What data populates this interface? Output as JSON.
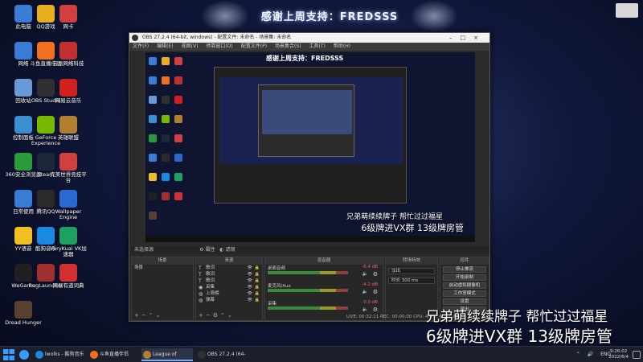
{
  "wallpaper": {
    "banner_text": "感谢上周支持：FREDSSS"
  },
  "desktop_icons": [
    {
      "label": "此电脑",
      "icon": "computer-icon",
      "color": "#3a7bd5"
    },
    {
      "label": "QQ游戏",
      "icon": "qq-game-icon",
      "color": "#e8b020"
    },
    {
      "label": "网卡",
      "icon": "network-card-icon",
      "color": "#d04040"
    },
    {
      "label": "网络",
      "icon": "network-icon",
      "color": "#3a7bd5"
    },
    {
      "label": "斗鱼直播伴侣",
      "icon": "douyu-icon",
      "color": "#f07020"
    },
    {
      "label": "云易网络科技",
      "icon": "cloud-icon",
      "color": "#c03030"
    },
    {
      "label": "回收站",
      "icon": "recycle-bin-icon",
      "color": "#6a9ad5"
    },
    {
      "label": "OBS Studio",
      "icon": "obs-icon",
      "color": "#303030"
    },
    {
      "label": "网易云音乐",
      "icon": "netease-music-icon",
      "color": "#d02020"
    },
    {
      "label": "控制面板",
      "icon": "control-panel-icon",
      "color": "#3a8fd0"
    },
    {
      "label": "GeForce Experience",
      "icon": "nvidia-icon",
      "color": "#76b900"
    },
    {
      "label": "英雄联盟",
      "icon": "lol-icon",
      "color": "#b08030"
    },
    {
      "label": "360安全浏览器",
      "icon": "browser-360-icon",
      "color": "#2a9a3a"
    },
    {
      "label": "Steam",
      "icon": "steam-icon",
      "color": "#1b2838"
    },
    {
      "label": "完美世界竞技平台",
      "icon": "perfect-world-icon",
      "color": "#d04040"
    },
    {
      "label": "日常使用",
      "icon": "folder-icon",
      "color": "#3a7bd5"
    },
    {
      "label": "腾讯QQ",
      "icon": "qq-icon",
      "color": "#2a2a2a"
    },
    {
      "label": "Wallpaper Engine",
      "icon": "wallpaper-engine-icon",
      "color": "#2a6ad0"
    },
    {
      "label": "YY语音",
      "icon": "yy-icon",
      "color": "#f0c020"
    },
    {
      "label": "酷狗音乐",
      "icon": "kugou-icon",
      "color": "#1a8ae0"
    },
    {
      "label": "VeryKuai VK加速器",
      "icon": "vk-accelerator-icon",
      "color": "#20a060"
    },
    {
      "label": "WeGame",
      "icon": "wegame-icon",
      "color": "#202020"
    },
    {
      "label": "BugLauncher",
      "icon": "bug-launcher-icon",
      "color": "#a03030"
    },
    {
      "label": "网易有道词典",
      "icon": "youdao-icon",
      "color": "#d03030"
    },
    {
      "label": "Dread Hunger",
      "icon": "dread-hunger-icon",
      "color": "#5a4030"
    }
  ],
  "obs": {
    "title": "OBS 27.2.4 (64-bit, windows) - 配置文件: 未命名 - 场景集: 未命名",
    "menus": [
      "文件(F)",
      "编辑(E)",
      "视图(V)",
      "停靠窗口(D)",
      "配置文件(P)",
      "场景集合(S)",
      "工具(T)",
      "帮助(H)"
    ],
    "scene_bar_label": "未选择源",
    "scene_bar_props": "属性",
    "scene_bar_filters": "滤镜",
    "docks": {
      "scenes": {
        "title": "场景",
        "items": [
          "场景"
        ]
      },
      "sources": {
        "title": "来源",
        "items": [
          "歌词",
          "歌词",
          "歌词",
          "采集",
          "上周榜",
          "弹幕"
        ]
      },
      "mixer": {
        "title": "混音器",
        "channels": [
          {
            "name": "桌面音频",
            "db": "-6.4 dB"
          },
          {
            "name": "麦克风/Aux",
            "db": "-4.2 dB"
          },
          {
            "name": "采集",
            "db": "0.0 dB"
          }
        ]
      },
      "transitions": {
        "title": "转场特效",
        "type": "淡出",
        "duration_label": "时长",
        "duration": "300 ms"
      },
      "controls": {
        "title": "控件",
        "buttons": [
          "停止推流",
          "开始录制",
          "启动虚拟摄像机",
          "工作室模式",
          "设置",
          "退出"
        ]
      }
    },
    "status": "LIVE: 00:32:11  REC: 00:00:00  CPU: 4.8%, 60.00 fps"
  },
  "overlay": {
    "line1": "兄弟萌续续牌子  帮忙过过福星",
    "line2": "6级牌进VX群  13级牌房管"
  },
  "taskbar": {
    "items": [
      {
        "label": "lwolks - 酷狗音乐",
        "color": "#1a8ae0",
        "active": false
      },
      {
        "label": "斗鱼直播伴侣",
        "color": "#f07020",
        "active": false
      },
      {
        "label": "League of Legends",
        "color": "#b08030",
        "active": true
      },
      {
        "label": "OBS 27.2.4 (64-bit...",
        "color": "#303030",
        "active": false
      }
    ],
    "lang": "ENG",
    "time": "9:26:02",
    "date": "2022/6/4"
  }
}
